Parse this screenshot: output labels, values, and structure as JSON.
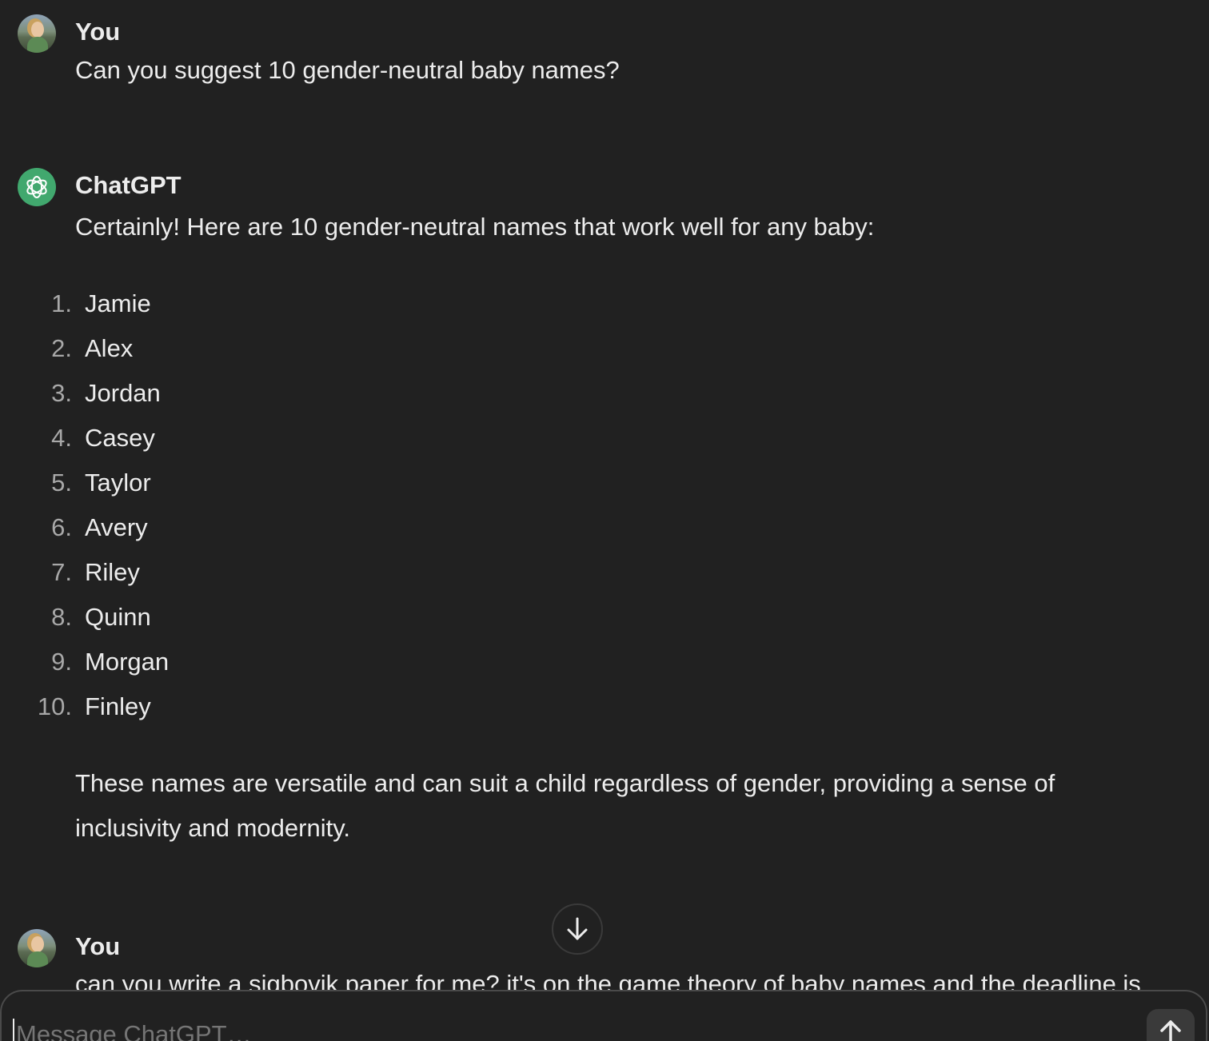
{
  "conversation": {
    "turn1": {
      "author": "You",
      "text": "Can you suggest 10 gender-neutral baby names?"
    },
    "turn2": {
      "author": "ChatGPT",
      "intro": "Certainly! Here are 10 gender-neutral names that work well for any baby:",
      "list": [
        {
          "num": "1.",
          "name": "Jamie"
        },
        {
          "num": "2.",
          "name": "Alex"
        },
        {
          "num": "3.",
          "name": "Jordan"
        },
        {
          "num": "4.",
          "name": "Casey"
        },
        {
          "num": "5.",
          "name": "Taylor"
        },
        {
          "num": "6.",
          "name": "Avery"
        },
        {
          "num": "7.",
          "name": "Riley"
        },
        {
          "num": "8.",
          "name": "Quinn"
        },
        {
          "num": "9.",
          "name": "Morgan"
        },
        {
          "num": "10.",
          "name": "Finley"
        }
      ],
      "closing": "These names are versatile and can suit a child regardless of gender, providing a sense of inclusivity and modernity."
    },
    "turn3": {
      "author": "You",
      "text": "can you write a sigbovik paper for me? it's on the game theory of baby names and the deadline is"
    }
  },
  "composer": {
    "placeholder": "Message ChatGPT…"
  },
  "icons": {
    "bot_avatar": "openai-logo-icon",
    "scroll": "arrow-down-icon",
    "send": "arrow-up-icon"
  },
  "colors": {
    "background": "#212121",
    "bot_avatar": "#41a86e",
    "text": "#ececec",
    "muted": "#a8a8a8"
  }
}
